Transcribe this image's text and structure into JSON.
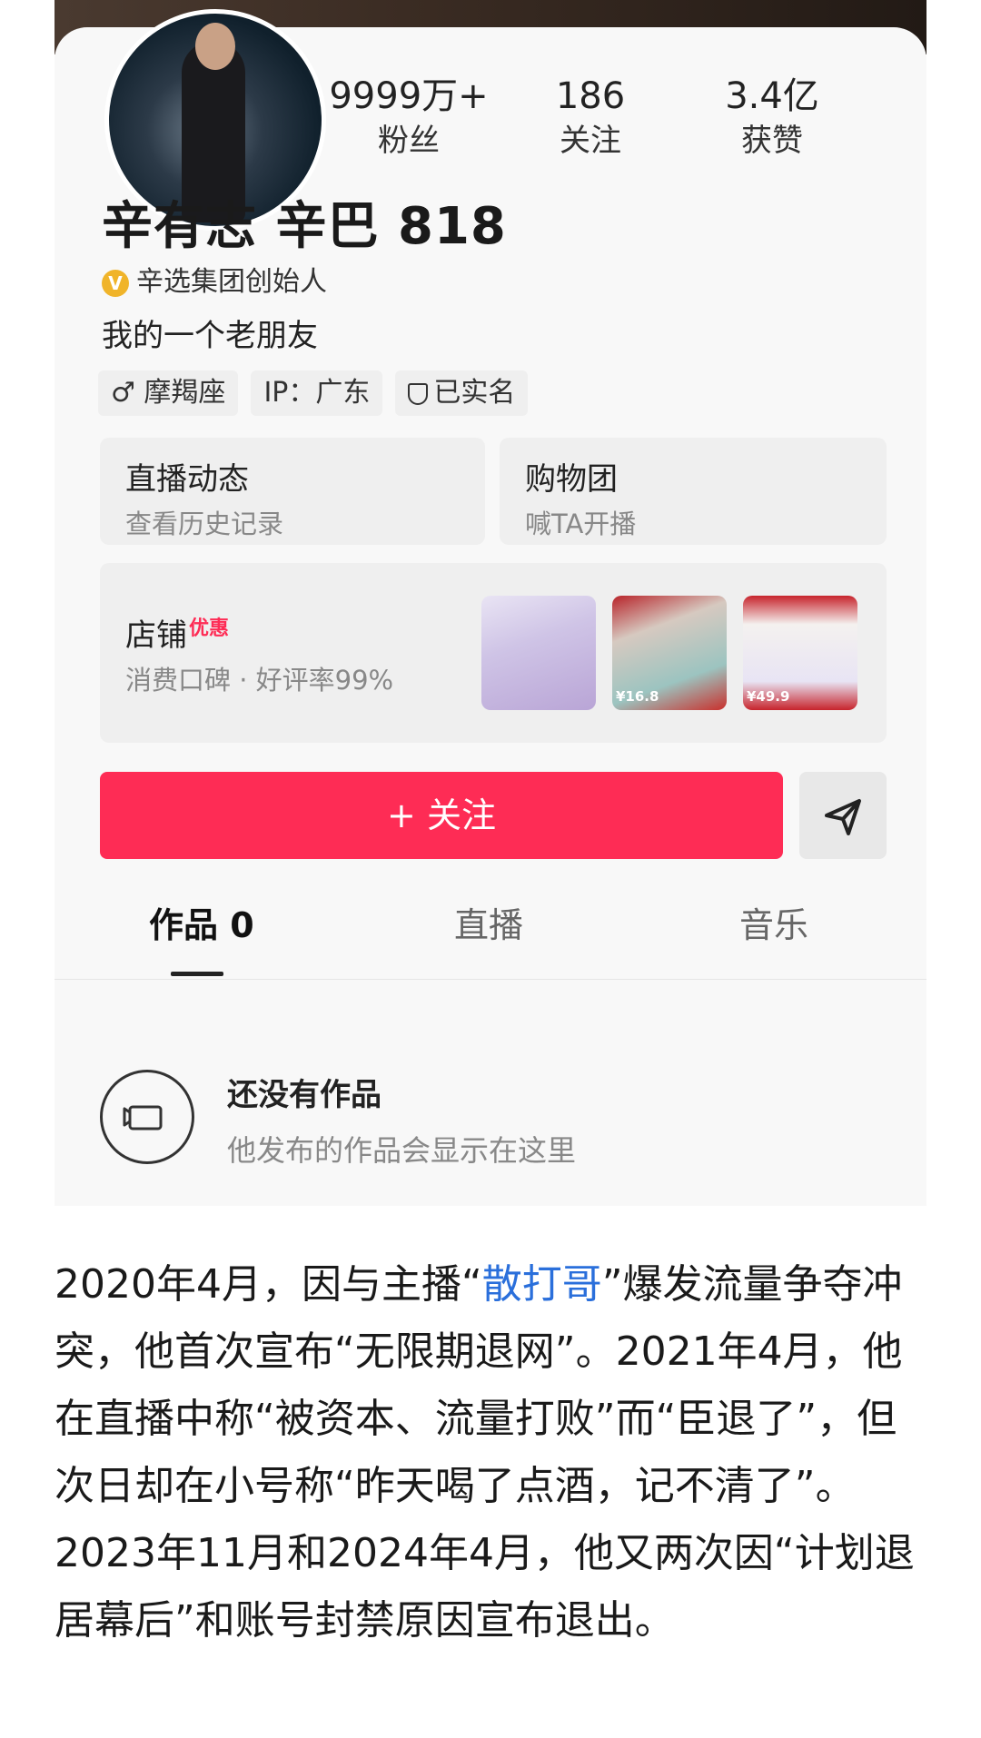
{
  "profile": {
    "stats": [
      {
        "value": "9999万+",
        "label": "粉丝"
      },
      {
        "value": "186",
        "label": "关注"
      },
      {
        "value": "3.4亿",
        "label": "获赞"
      }
    ],
    "name": "辛有志 辛巴 818",
    "verification": "辛选集团创始人",
    "bio": "我的一个老朋友",
    "tags": [
      "♂ 摩羯座",
      "IP：广东",
      "已实名"
    ]
  },
  "live_box": {
    "title": "直播动态",
    "subtitle": "查看历史记录"
  },
  "group_box": {
    "title": "购物团",
    "subtitle": "喊TA开播"
  },
  "shop_box": {
    "title": "店铺",
    "badge": "优惠",
    "subtitle": "消费口碑 · 好评率99%",
    "thumbnails": [
      {
        "price": ""
      },
      {
        "price": "¥16.8"
      },
      {
        "price": "¥49.9"
      }
    ]
  },
  "follow_button": "+ 关注",
  "tabs": {
    "works": "作品 0",
    "live": "直播",
    "music": "音乐"
  },
  "empty_state": {
    "title": "还没有作品",
    "subtitle": "他发布的作品会显示在这里"
  },
  "article": {
    "part1": "2020年4月，因与主播“",
    "link": "散打哥",
    "part2": "”爆发流量争夺冲突，他首次宣布“无限期退网”。2021年4月，他在直播中称“被资本、流量打败”而“臣退了”，但次日却在小号称“昨天喝了点酒，记不清了”。2023年11月和2024年4月，他又两次因“计划退居幕后”和账号封禁原因宣布退出。"
  },
  "colors": {
    "accent": "#fe2c55",
    "link": "#2a6fdb",
    "verify_badge": "#f0b42a"
  }
}
